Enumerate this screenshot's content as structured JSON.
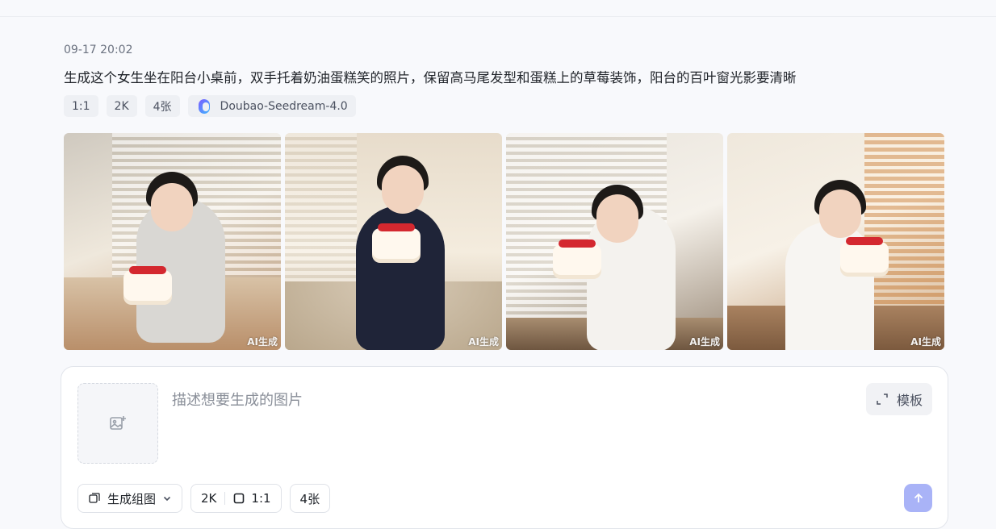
{
  "message": {
    "timestamp": "09-17 20:02",
    "prompt": "生成这个女生坐在阳台小桌前，双手托着奶油蛋糕笑的照片，保留高马尾发型和蛋糕上的草莓装饰，阳台的百叶窗光影要清晰",
    "tags": {
      "ratio": "1:1",
      "resolution": "2K",
      "count": "4张",
      "model": "Doubao-Seedream-4.0"
    },
    "images": [
      {
        "badge": "AI生成"
      },
      {
        "badge": "AI生成"
      },
      {
        "badge": "AI生成"
      },
      {
        "badge": "AI生成"
      }
    ]
  },
  "composer": {
    "placeholder": "描述想要生成的图片",
    "template_label": "模板",
    "mode_label": "生成组图",
    "resolution": "2K",
    "ratio": "1:1",
    "count": "4张"
  },
  "icons": {
    "model": "model-logo-icon",
    "upload": "image-add-icon",
    "template": "expand-icon",
    "mode": "image-group-icon",
    "dropdown": "chevron-down-icon",
    "ratio": "square-icon",
    "send": "arrow-up-icon"
  },
  "colors": {
    "background": "#f8f9fc",
    "tag_bg": "#eef0f4",
    "send_button": "#a9b3f7"
  }
}
